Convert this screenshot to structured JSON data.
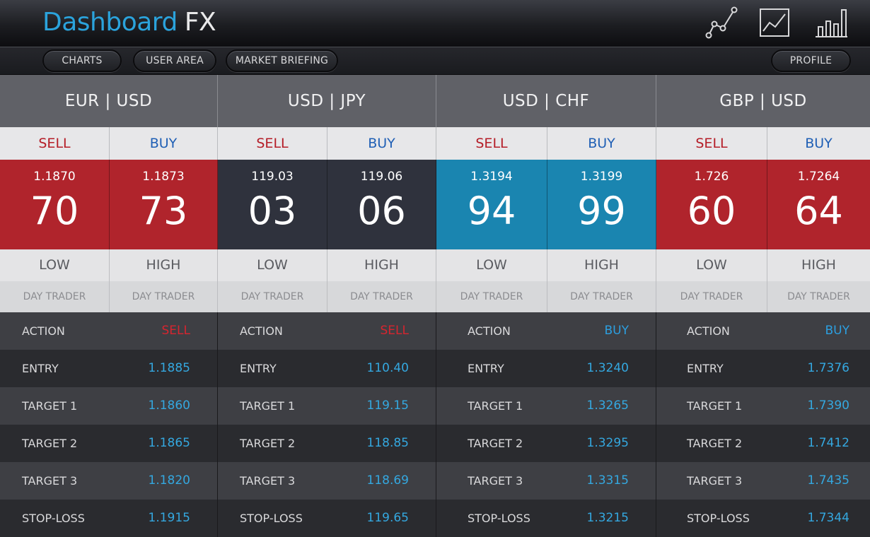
{
  "header": {
    "brand_primary": "Dashboard",
    "brand_secondary": "FX",
    "icons": [
      "line-chart-icon",
      "area-chart-icon",
      "bar-chart-icon"
    ]
  },
  "nav": {
    "charts": "CHARTS",
    "user_area": "USER AREA",
    "market_briefing": "MARKET BRIEFING",
    "profile": "PROFILE"
  },
  "colors": {
    "brand_blue": "#2ba3dc",
    "sell_red": "#b0242c",
    "neutral_dark": "#2f323d",
    "buy_blue": "#1a85b0"
  },
  "labels": {
    "sell": "SELL",
    "buy": "BUY",
    "low": "LOW",
    "high": "HIGH",
    "day_trader": "DAY TRADER",
    "action": "ACTION",
    "entry": "ENTRY",
    "target1": "TARGET 1",
    "target2": "TARGET 2",
    "target3": "TARGET 3",
    "stop_loss": "STOP-LOSS"
  },
  "pairs": [
    {
      "name": "EUR | USD",
      "sell": {
        "price": "1.1870",
        "pips": "70"
      },
      "buy": {
        "price": "1.1873",
        "pips": "73"
      },
      "signal": {
        "action": "SELL",
        "entry": "1.1885",
        "target1": "1.1860",
        "target2": "1.1865",
        "target3": "1.1820",
        "stop_loss": "1.1915"
      }
    },
    {
      "name": "USD | JPY",
      "sell": {
        "price": "119.03",
        "pips": "03"
      },
      "buy": {
        "price": "119.06",
        "pips": "06"
      },
      "signal": {
        "action": "SELL",
        "entry": "110.40",
        "target1": "119.15",
        "target2": "118.85",
        "target3": "118.69",
        "stop_loss": "119.65"
      }
    },
    {
      "name": "USD | CHF",
      "sell": {
        "price": "1.3194",
        "pips": "94"
      },
      "buy": {
        "price": "1.3199",
        "pips": "99"
      },
      "signal": {
        "action": "BUY",
        "entry": "1.3240",
        "target1": "1.3265",
        "target2": "1.3295",
        "target3": "1.3315",
        "stop_loss": "1.3215"
      }
    },
    {
      "name": "GBP | USD",
      "sell": {
        "price": "1.726",
        "pips": "60"
      },
      "buy": {
        "price": "1.7264",
        "pips": "64"
      },
      "signal": {
        "action": "BUY",
        "entry": "1.7376",
        "target1": "1.7390",
        "target2": "1.7412",
        "target3": "1.7435",
        "stop_loss": "1.7344"
      }
    }
  ]
}
